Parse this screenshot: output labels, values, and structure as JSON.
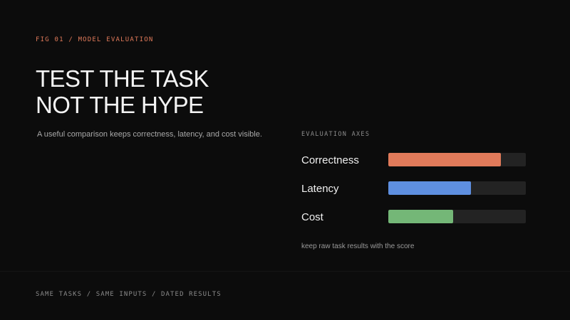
{
  "eyebrow": "FIG 01 / MODEL EVALUATION",
  "headline": {
    "line1": "TEST THE TASK",
    "line2": "NOT THE HYPE"
  },
  "lede": "A useful comparison keeps correctness, latency, and cost visible.",
  "axes_panel": {
    "label": "EVALUATION AXES",
    "items": [
      {
        "label": "Correctness",
        "level": 0.82,
        "color": "#e07a5a"
      },
      {
        "label": "Latency",
        "level": 0.6,
        "color": "#5e8fe0"
      },
      {
        "label": "Cost",
        "level": 0.47,
        "color": "#74b777"
      }
    ],
    "note": "keep raw task results with the score"
  },
  "footer": "SAME TASKS / SAME INPUTS / DATED RESULTS",
  "colors": {
    "background": "#0c0c0c",
    "accent": "#e07a5a",
    "track": "#232323"
  }
}
